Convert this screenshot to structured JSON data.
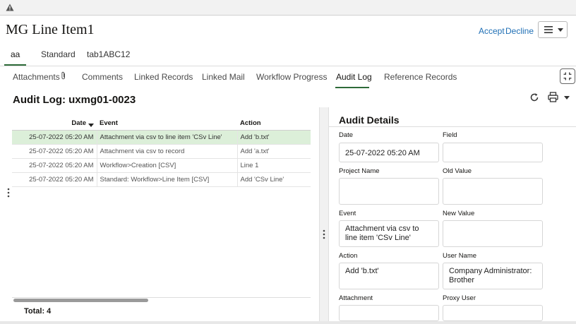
{
  "record": {
    "title": "MG Line Item1",
    "accept_label": "Accept",
    "decline_label": "Decline"
  },
  "subtabs": [
    "aa",
    "Standard",
    "tab1ABC12"
  ],
  "tabs": [
    "Attachments",
    "Comments",
    "Linked Records",
    "Linked Mail",
    "Workflow Progress",
    "Audit Log",
    "Reference Records"
  ],
  "active_tab": "Audit Log",
  "audit_log": {
    "heading": "Audit Log: uxmg01-0023",
    "columns": {
      "date": "Date",
      "event": "Event",
      "action": "Action"
    },
    "rows": [
      {
        "date": "25-07-2022 05:20 AM",
        "event": "Attachment via csv to line item 'CSv Line'",
        "action": "Add 'b.txt'"
      },
      {
        "date": "25-07-2022 05:20 AM",
        "event": "Attachment via csv to record",
        "action": "Add 'a.txt'"
      },
      {
        "date": "25-07-2022 05:20 AM",
        "event": "Workflow>Creation [CSV]",
        "action": "Line 1"
      },
      {
        "date": "25-07-2022 05:20 AM",
        "event": "Standard: Workflow>Line Item [CSV]",
        "action": "Add 'CSv Line'"
      }
    ],
    "total_label": "Total: 4",
    "selected_row": 0
  },
  "details": {
    "title": "Audit Details",
    "labels": {
      "date": "Date",
      "field": "Field",
      "project_name": "Project Name",
      "old_value": "Old Value",
      "event": "Event",
      "new_value": "New Value",
      "action": "Action",
      "user_name": "User Name",
      "attachment": "Attachment",
      "proxy_user": "Proxy User"
    },
    "values": {
      "date": "25-07-2022 05:20 AM",
      "field": "",
      "project_name": "",
      "old_value": "",
      "event": "Attachment via csv to line item 'CSv Line'",
      "new_value": "",
      "action": "Add 'b.txt'",
      "user_name": "Company Administrator: Brother",
      "attachment": "",
      "proxy_user": ""
    }
  },
  "icons": [
    "warning-icon",
    "hamburger-icon",
    "paperclip-icon",
    "expand-icon",
    "refresh-icon",
    "print-icon",
    "sort-desc-icon",
    "drag-handle-icon"
  ],
  "colors": {
    "accent_green": "#2e6b39",
    "link_blue": "#1f6fb5",
    "selected_row": "#dcefd9"
  }
}
